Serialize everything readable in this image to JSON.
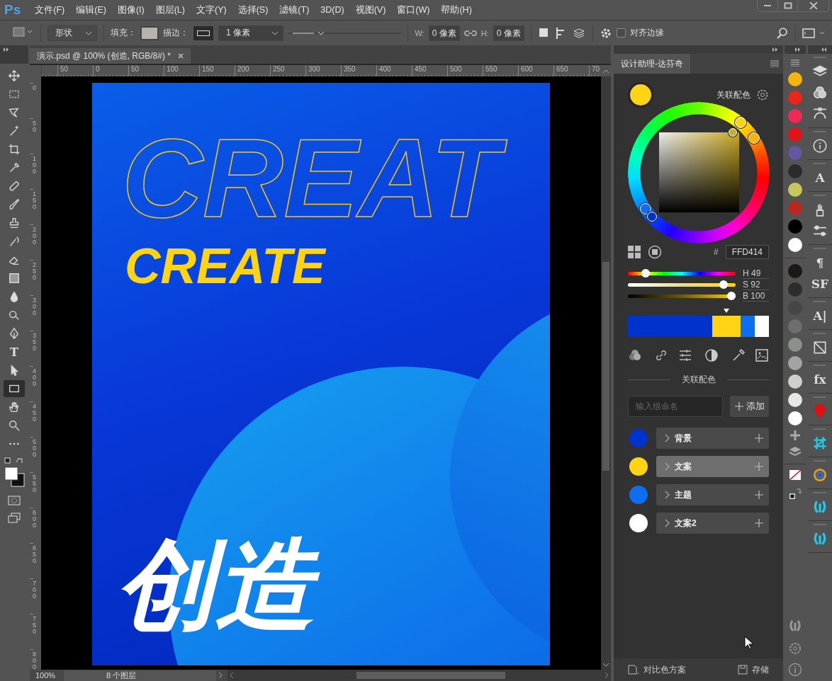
{
  "app": {
    "logo": "Ps"
  },
  "menu": [
    "文件(F)",
    "编辑(E)",
    "图像(I)",
    "图层(L)",
    "文字(Y)",
    "选择(S)",
    "滤镜(T)",
    "3D(D)",
    "视图(V)",
    "窗口(W)",
    "帮助(H)"
  ],
  "options": {
    "mode": "形状",
    "fill_label": "填充：",
    "stroke_label": "描边：",
    "stroke_width": "1 像素",
    "w_label": "W:",
    "w_value": "0 像素",
    "h_label": "H:",
    "h_value": "0 像素",
    "snap": {
      "label": "对齐边缘",
      "checked": false
    }
  },
  "tools": [
    {
      "kind": "move",
      "selected": false
    },
    {
      "kind": "marquee",
      "selected": false
    },
    {
      "kind": "lasso",
      "selected": false
    },
    {
      "kind": "wand",
      "selected": false
    },
    {
      "kind": "crop",
      "selected": false
    },
    {
      "kind": "eyedropper",
      "selected": false
    },
    {
      "kind": "healing",
      "selected": false
    },
    {
      "kind": "brush",
      "selected": false
    },
    {
      "kind": "stamp",
      "selected": false
    },
    {
      "kind": "history",
      "selected": false
    },
    {
      "kind": "eraser",
      "selected": false
    },
    {
      "kind": "gradient",
      "selected": false
    },
    {
      "kind": "drop",
      "selected": false
    },
    {
      "kind": "dodge",
      "selected": false
    },
    {
      "kind": "pen",
      "selected": false
    },
    {
      "kind": "glyph",
      "label": "T",
      "selected": false
    },
    {
      "kind": "arrow",
      "selected": false
    },
    {
      "kind": "rectangle",
      "selected": true
    },
    {
      "kind": "hand",
      "selected": false
    },
    {
      "kind": "zoom",
      "selected": false
    },
    {
      "kind": "more",
      "selected": false
    }
  ],
  "document": {
    "tab_title": "演示.psd @ 100% (创造, RGB/8#) *",
    "ruler_h": [
      "50",
      "0",
      "50",
      "100",
      "150",
      "200",
      "250",
      "300",
      "350",
      "400",
      "450",
      "500",
      "550",
      "600",
      "650",
      "70"
    ],
    "ruler_v": [
      "0",
      "50",
      "100",
      "150",
      "200",
      "250",
      "300",
      "350",
      "400",
      "450",
      "500",
      "550",
      "600",
      "650",
      "700",
      "750",
      "800"
    ],
    "art": {
      "outline_title": "CREAT",
      "title": "CREATE",
      "headline": "创造"
    },
    "zoom": "100%",
    "layers_info": "8 个图层"
  },
  "panel": {
    "tab": "设计助理-达芬奇",
    "scheme_label": "关联配色",
    "hex_label": "#",
    "hex": "FFD414",
    "sliders": [
      {
        "kind": "hue",
        "reading": "H 49",
        "level": 0.136
      },
      {
        "kind": "saturation",
        "reading": "S 92",
        "level": 0.92
      },
      {
        "kind": "brightness",
        "reading": "B 100",
        "level": 1
      }
    ],
    "palette": [
      {
        "color": "#0033cc",
        "selected": false
      },
      {
        "color": "#ffd414",
        "selected": true
      },
      {
        "color": "#0d6ef0",
        "selected": false
      },
      {
        "color": "#ffffff",
        "selected": false
      }
    ],
    "section_title": "关联配色",
    "group_input": {
      "placeholder": "输入组命名"
    },
    "add_button": "添加",
    "groups": [
      {
        "name": "背景",
        "color": "#0033cc",
        "selected": false
      },
      {
        "name": "文案",
        "color": "#ffd414",
        "selected": true
      },
      {
        "name": "主题",
        "color": "#0d6ef0",
        "selected": false
      },
      {
        "name": "文案2",
        "color": "#ffffff",
        "selected": false
      }
    ],
    "footer": {
      "scheme": "对比色方案",
      "save": "存储"
    }
  },
  "swatches": [
    {
      "color": "#f5b50c"
    },
    {
      "color": "#e8261a"
    },
    {
      "color": "#ee2a55"
    },
    {
      "color": "#e0131c"
    },
    {
      "color": "#6655a0"
    },
    {
      "color": "#2b2b2d"
    },
    {
      "color": "#c5c95a"
    },
    {
      "color": "#b8281e"
    },
    {
      "color": "#000000"
    },
    {
      "color": "#ffffff"
    }
  ],
  "swatches_gray": [
    {
      "color": "#1b1815"
    },
    {
      "color": "#2e2c2a"
    },
    {
      "color": "#464646"
    },
    {
      "color": "#6e6e6e"
    },
    {
      "color": "#8c908c"
    },
    {
      "color": "#a3a3a3"
    },
    {
      "color": "#cfcfcb"
    },
    {
      "color": "#e6e6e2"
    },
    {
      "color": "#ffffff"
    }
  ],
  "side_panels": [
    {
      "icons": [
        {
          "kind": "layers"
        },
        {
          "kind": "channels"
        },
        {
          "kind": "paths"
        }
      ]
    },
    {
      "icons": [
        {
          "kind": "info"
        }
      ]
    },
    {
      "icons": [
        {
          "kind": "text",
          "label": "A"
        }
      ]
    },
    {
      "icons": [
        {
          "kind": "brushes"
        },
        {
          "kind": "brush-settings"
        }
      ]
    },
    {
      "icons": [
        {
          "kind": "text",
          "label": "¶"
        },
        {
          "kind": "text",
          "label": "SF"
        }
      ]
    },
    {
      "icons": [
        {
          "kind": "text",
          "label": "A|"
        }
      ]
    },
    {
      "icons": [
        {
          "kind": "transform"
        }
      ]
    },
    {
      "icons": [
        {
          "kind": "text",
          "label": "fx"
        }
      ]
    },
    {
      "icons": [
        {
          "kind": "pin"
        }
      ]
    },
    {
      "icons": [
        {
          "kind": "grid"
        }
      ]
    },
    {
      "icons": [
        {
          "kind": "ring"
        }
      ]
    },
    {
      "icons": [
        {
          "kind": "bird"
        }
      ]
    },
    {
      "icons": [
        {
          "kind": "bird"
        }
      ]
    }
  ]
}
